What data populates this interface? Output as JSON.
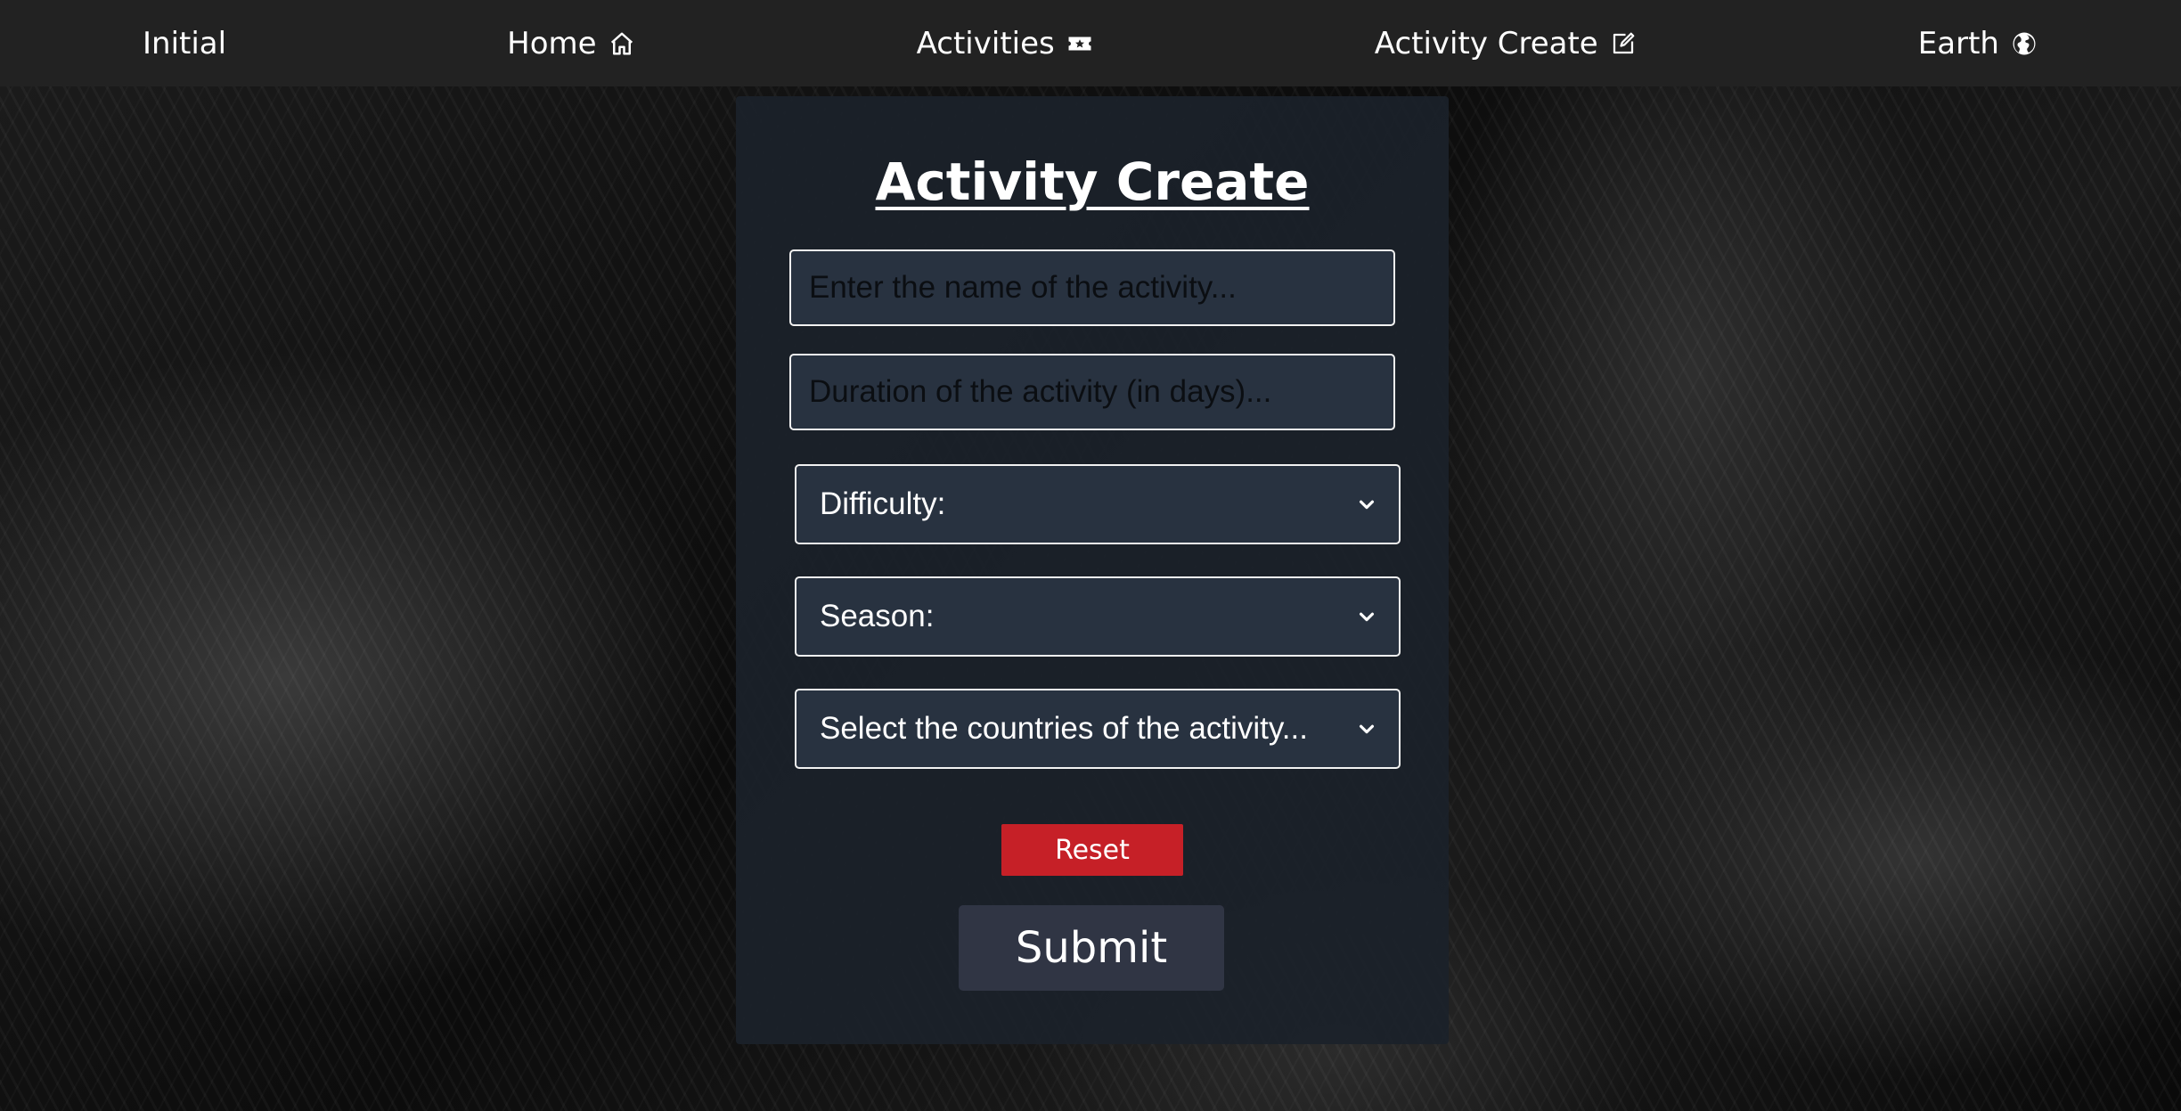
{
  "nav": {
    "items": [
      {
        "label": "Initial",
        "icon": ""
      },
      {
        "label": "Home",
        "icon": "home-icon"
      },
      {
        "label": "Activities",
        "icon": "ticket-icon"
      },
      {
        "label": "Activity Create",
        "icon": "edit-icon"
      },
      {
        "label": "Earth",
        "icon": "globe-icon"
      }
    ]
  },
  "form": {
    "title": "Activity Create",
    "name_placeholder": "Enter the name of the activity...",
    "duration_placeholder": "Duration of the activity (in days)...",
    "difficulty_selected": "Difficulty:",
    "season_selected": "Season:",
    "countries_selected": "Select the countries of the activity...",
    "reset_label": "Reset",
    "submit_label": "Submit"
  },
  "colors": {
    "navbar_bg": "#222222",
    "card_bg": "#1b212a",
    "input_bg": "#283240",
    "reset_bg": "#c62027",
    "submit_bg": "#303544"
  }
}
